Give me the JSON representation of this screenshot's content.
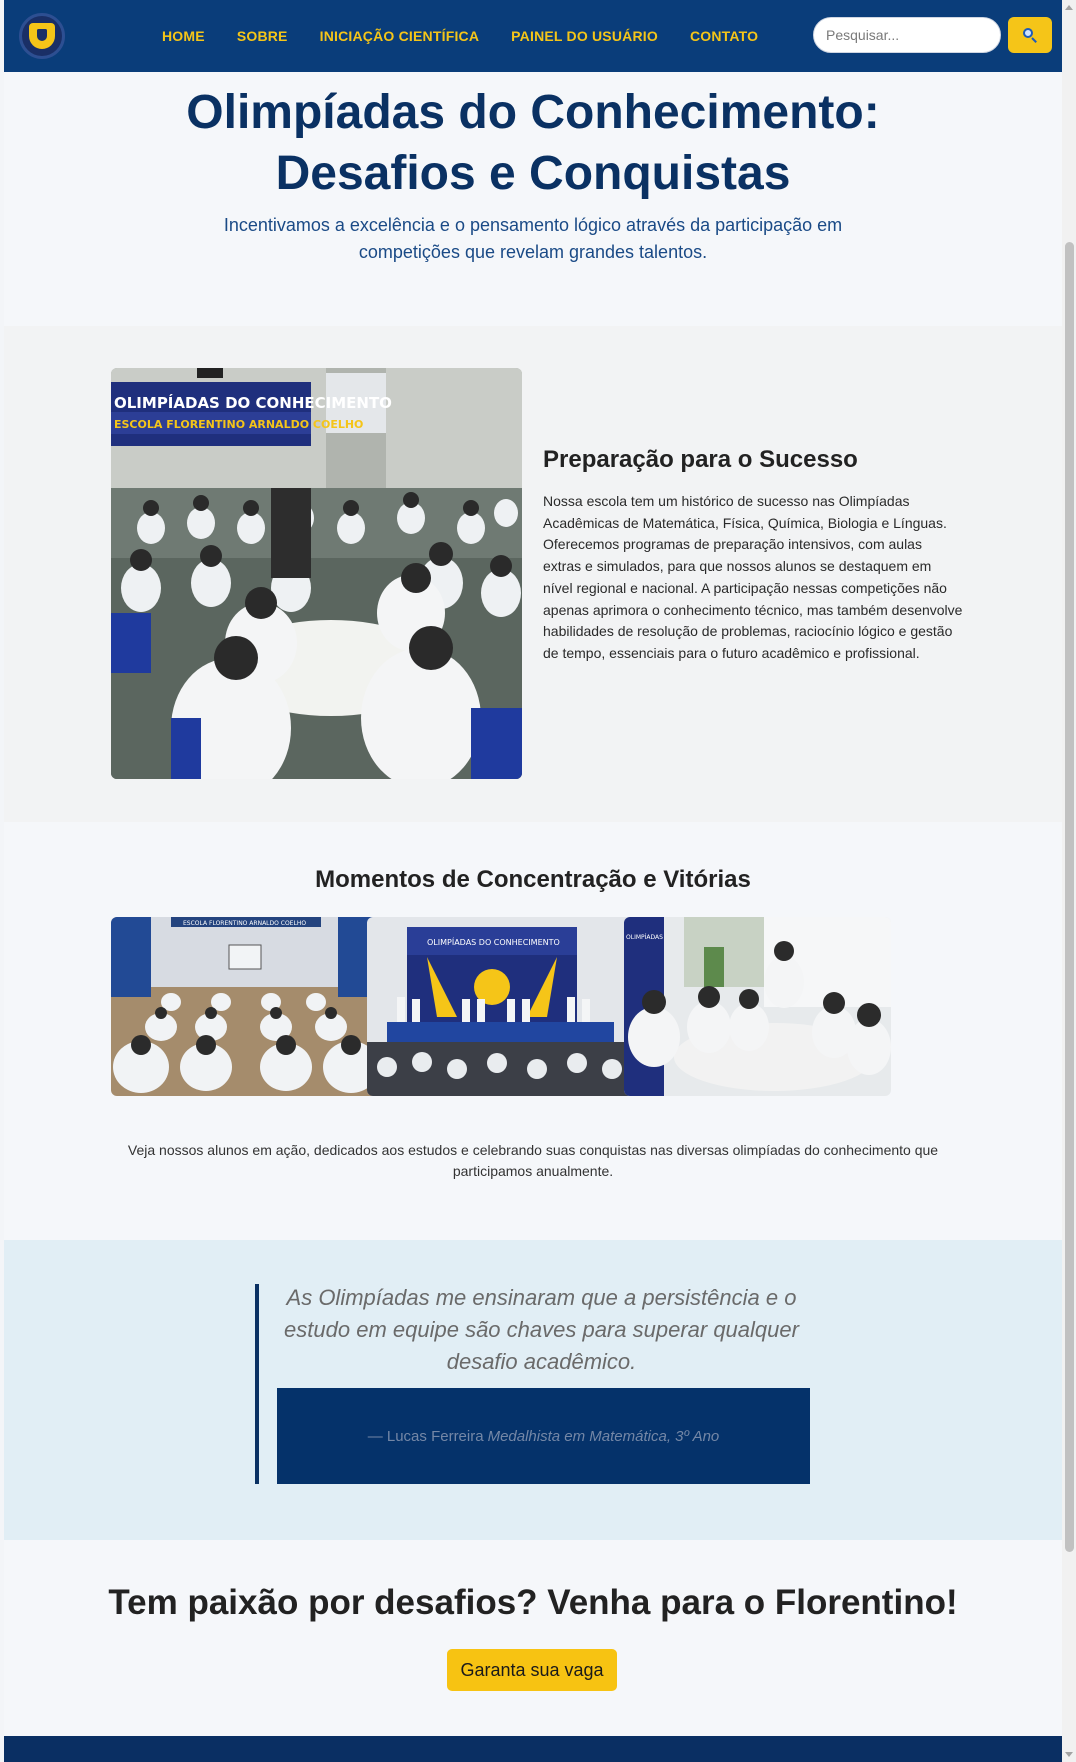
{
  "nav": {
    "items": [
      "HOME",
      "SOBRE",
      "INICIAÇÃO CIENTÍFICA",
      "PAINEL DO USUÁRIO",
      "CONTATO"
    ],
    "search_placeholder": "Pesquisar..."
  },
  "hero": {
    "title_line1": "Olimpíadas do Conhecimento:",
    "title_line2": "Desafios e Conquistas",
    "subtitle": "Incentivamos a excelência e o pensamento lógico através da participação em competições que revelam grandes talentos."
  },
  "prep": {
    "banner_line1": "OLIMPÍADAS DO CONHECIMENTO",
    "banner_line2": "ESCOLA FLORENTINO ARNALDO COELHO",
    "title": "Preparação para o Sucesso",
    "text": "Nossa escola tem um histórico de sucesso nas Olimpíadas Acadêmicas de Matemática, Física, Química, Biologia e Línguas. Oferecemos programas de preparação intensivos, com aulas extras e simulados, para que nossos alunos se destaquem em nível regional e nacional. A participação nessas competições não apenas aprimora o conhecimento técnico, mas também desenvolve habilidades de resolução de problemas, raciocínio lógico e gestão de tempo, essenciais para o futuro acadêmico e profissional."
  },
  "gallery": {
    "title": "Momentos de Concentração e Vitórias",
    "images": [
      {
        "caption": "ESCOLA FLORENTINO ARNALDO COELHO"
      },
      {
        "caption": "OLIMPÍADAS DO CONHECIMENTO"
      },
      {
        "caption": "OLIMPÍADAS"
      }
    ],
    "text": "Veja nossos alunos em ação, dedicados aos estudos e celebrando suas conquistas nas diversas olimpíadas do conhecimento que participamos anualmente."
  },
  "testimonial": {
    "quote": "As Olimpíadas me ensinaram que a persistência e o estudo em equipe são chaves para superar qualquer desafio acadêmico.",
    "author": "— Lucas Ferreira",
    "role": "Medalhista em Matemática, 3º Ano"
  },
  "cta": {
    "title": "Tem paixão por desafios? Venha para o Florentino!",
    "button": "Garanta sua vaga"
  },
  "colors": {
    "primary": "#0a3d7a",
    "accent": "#f5c518",
    "quote_bg": "#e1eef5"
  }
}
